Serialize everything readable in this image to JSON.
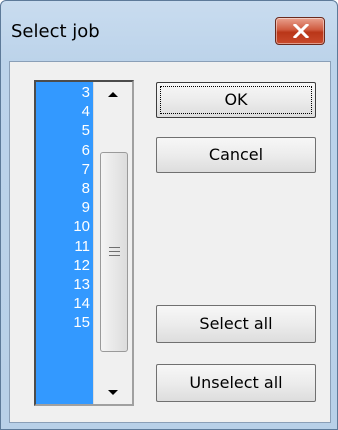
{
  "window": {
    "title": "Select job",
    "close_icon": "close-icon"
  },
  "job_list": {
    "items": [
      "3",
      "4",
      "5",
      "6",
      "7",
      "8",
      "9",
      "10",
      "11",
      "12",
      "13",
      "14",
      "15"
    ],
    "selection_color": "#3399ff"
  },
  "buttons": {
    "ok": "OK",
    "cancel": "Cancel",
    "select_all": "Select all",
    "unselect_all": "Unselect all"
  }
}
